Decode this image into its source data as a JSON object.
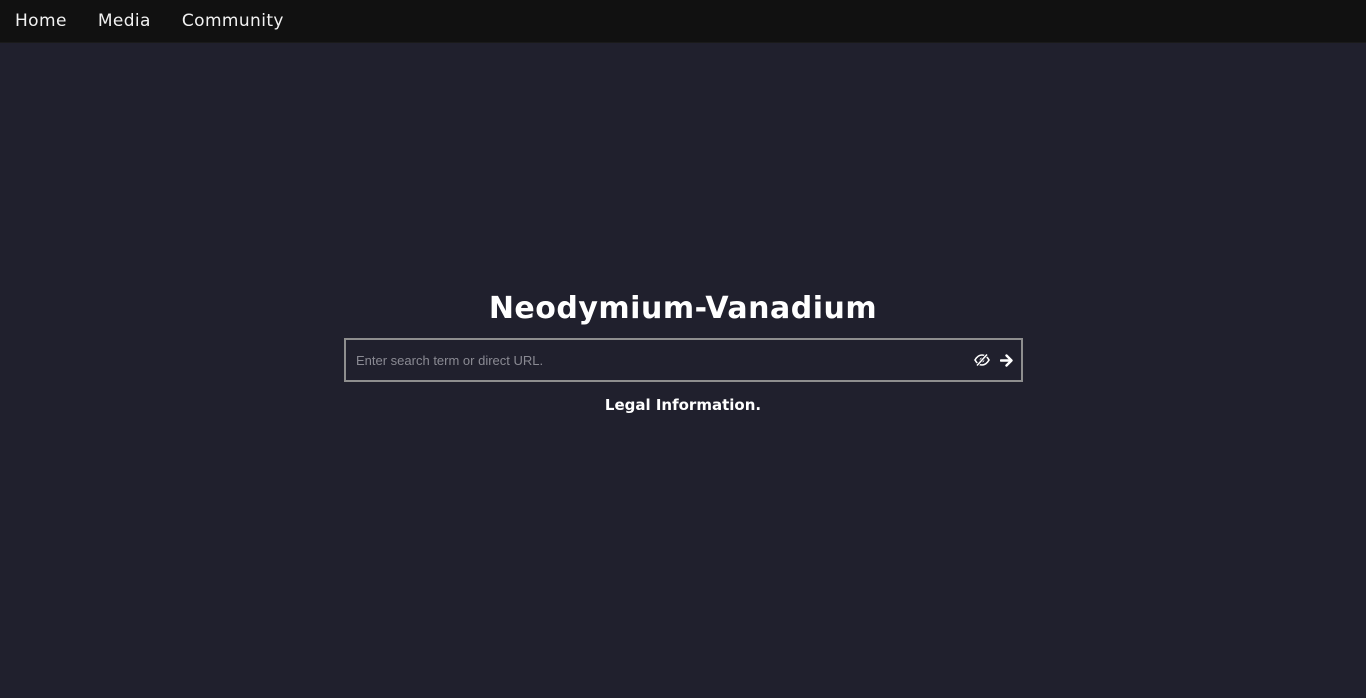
{
  "nav": {
    "items": [
      {
        "label": "Home"
      },
      {
        "label": "Media"
      },
      {
        "label": "Community"
      }
    ]
  },
  "main": {
    "title": "Neodymium-Vanadium",
    "search": {
      "placeholder": "Enter search term or direct URL.",
      "value": "",
      "icons": [
        "eye-slash-icon",
        "arrow-right-icon"
      ]
    },
    "legal_link": "Legal Information."
  },
  "colors": {
    "background": "#20202d",
    "navbar": "#111111",
    "search_border": "#8e8e8e",
    "text": "#ffffff"
  }
}
